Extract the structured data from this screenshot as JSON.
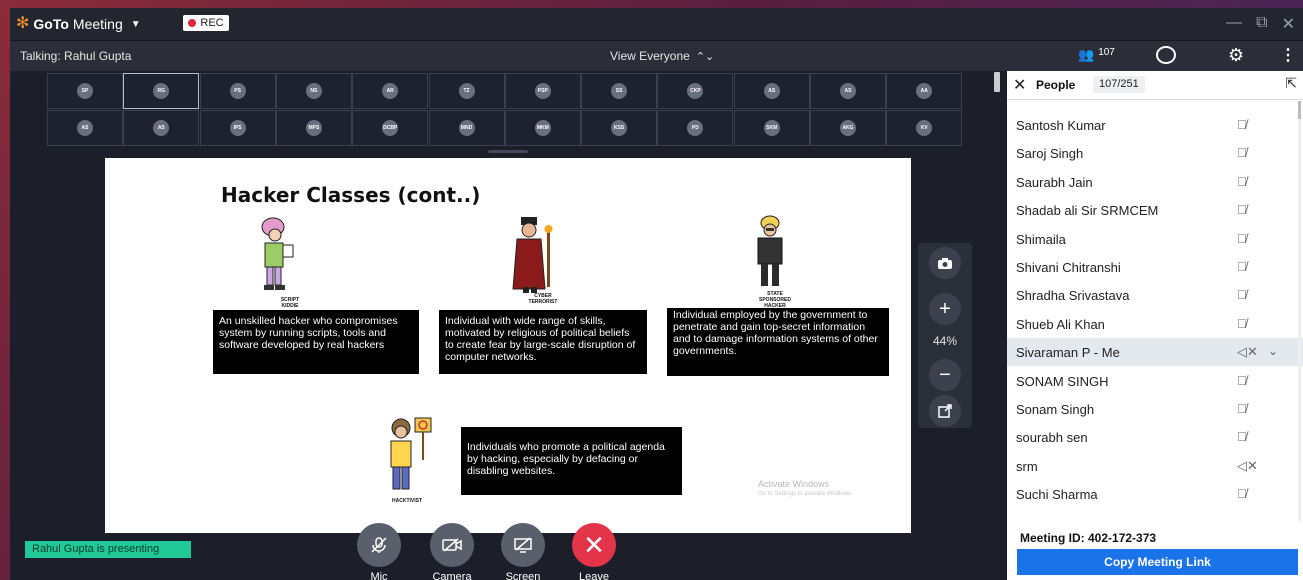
{
  "app": {
    "brand_a": "GoTo",
    "brand_b": "Meeting",
    "rec": "REC"
  },
  "window_controls": {
    "minimize": "—",
    "restore": "⧉",
    "close": "✕"
  },
  "toolbar": {
    "talking": "Talking: Rahul Gupta",
    "view": "View Everyone",
    "people_count": "107"
  },
  "attendees": [
    "SP",
    "RG",
    "PS",
    "NS",
    "AR",
    "TZ",
    "PSP",
    "SS",
    "CKP",
    "AS",
    "AS",
    "AA",
    "AS",
    "AS",
    "IPS",
    "MPS",
    "DCBP",
    "MND",
    "MKM",
    "KSS",
    "PD",
    "SKM",
    "AKG",
    "KV"
  ],
  "slide": {
    "title": "Hacker Classes (cont..)",
    "cap1": "SCRIPT KIDDIE",
    "cap2": "CYBER TERRORIST",
    "cap3": "STATE SPONSORED HACKER",
    "cap4": "HACKTIVIST",
    "box1": "An unskilled hacker who compromises system by running scripts, tools and software developed by real hackers",
    "box2": "Individual with wide range of skills, motivated by religious of political beliefs to create fear by large-scale disruption of computer networks.",
    "box3": "Individual employed by the government to penetrate and gain top-secret information and to damage information systems of other governments.",
    "box4": "Individuals who promote a political agenda by hacking, especially by defacing or disabling websites.",
    "wm1": "Activate Windows",
    "wm2": "Go to Settings to activate Windows."
  },
  "zoom": {
    "level": "44%"
  },
  "presenting": "Rahul Gupta is presenting",
  "controls": {
    "mic": "Mic",
    "camera": "Camera",
    "screen": "Screen",
    "leave": "Leave"
  },
  "panel": {
    "title": "People",
    "count": "107/251",
    "people": [
      {
        "name": "Santosh Kumar"
      },
      {
        "name": "Saroj Singh"
      },
      {
        "name": "Saurabh Jain"
      },
      {
        "name": "Shadab ali Sir SRMCEM"
      },
      {
        "name": "Shimaila"
      },
      {
        "name": "Shivani Chitranshi"
      },
      {
        "name": "Shradha Srivastava"
      },
      {
        "name": "Shueb Ali Khan"
      },
      {
        "name": "Sivaraman P  - Me"
      },
      {
        "name": "SONAM SINGH"
      },
      {
        "name": "Sonam Singh"
      },
      {
        "name": "sourabh sen"
      },
      {
        "name": "srm"
      },
      {
        "name": "Suchi Sharma"
      }
    ],
    "meeting_id": "Meeting ID:  402-172-373",
    "copy_link": "Copy Meeting Link"
  },
  "colors": {
    "accent": "#1a73e8",
    "presenting": "#20c997",
    "leave": "#e4344a",
    "rec": "#e0263a"
  }
}
